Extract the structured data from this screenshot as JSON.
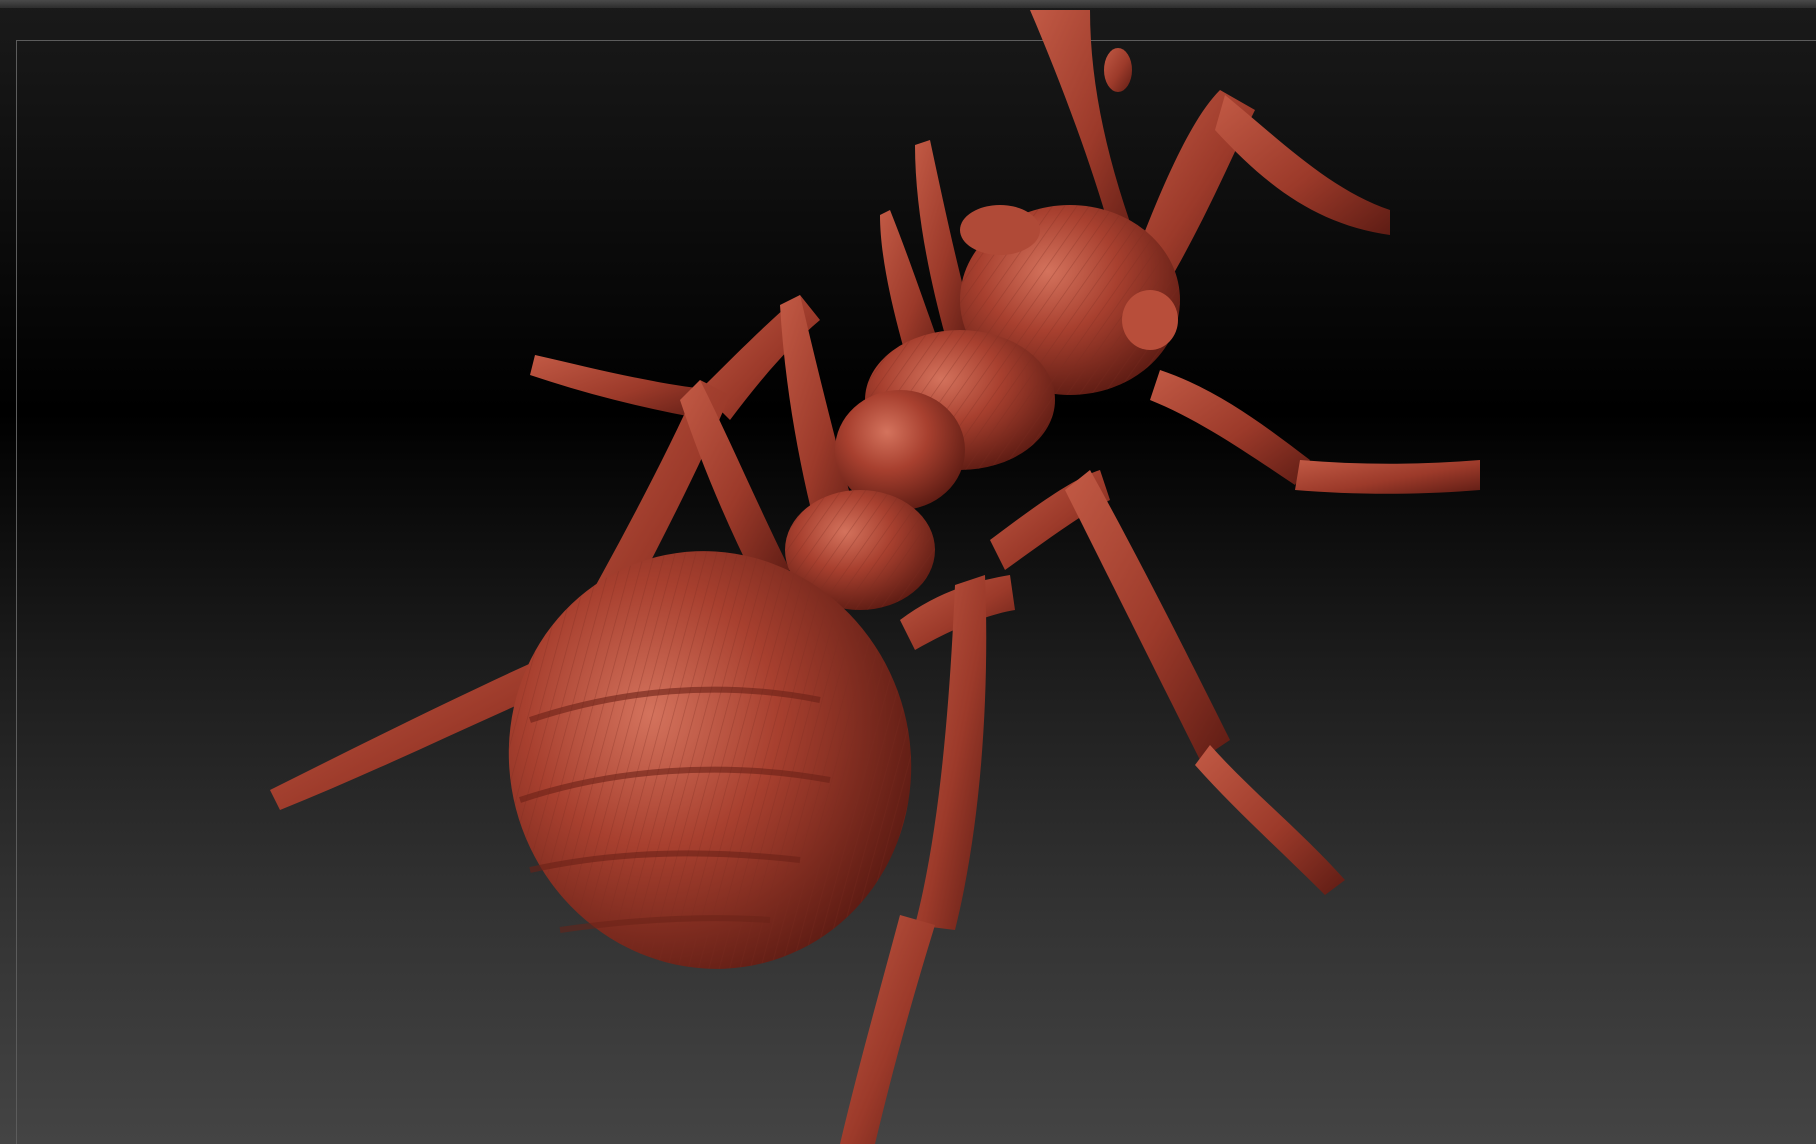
{
  "viewport": {
    "model": "sculpted-ant",
    "material_color": "#a8402f",
    "material_highlight": "#d97a65",
    "material_shadow": "#5a1a12",
    "frame_color": "#5c5c5c"
  }
}
